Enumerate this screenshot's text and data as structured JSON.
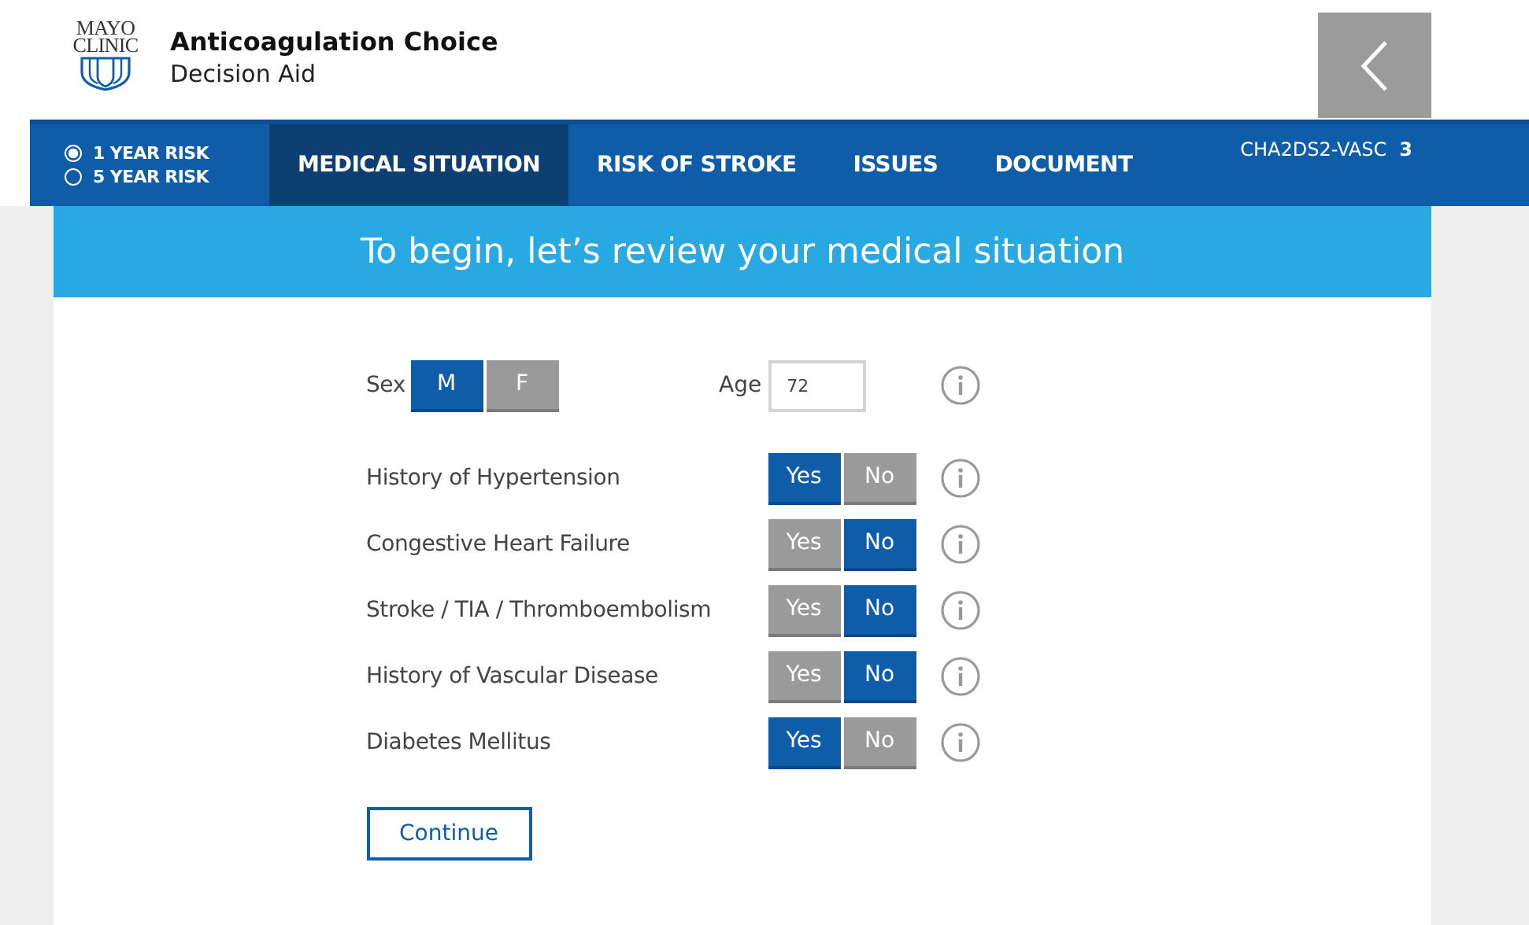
{
  "logo": {
    "line_1": "MAYO",
    "line_2": "CLINIC"
  },
  "app": {
    "title": "Anticoagulation Choice",
    "subtitle": "Decision Aid"
  },
  "risk_options": [
    {
      "label": "1 YEAR RISK",
      "selected": true
    },
    {
      "label": "5 YEAR RISK",
      "selected": false
    }
  ],
  "tabs": [
    {
      "label": "MEDICAL SITUATION",
      "selected": true
    },
    {
      "label": "RISK OF STROKE",
      "selected": false
    },
    {
      "label": "ISSUES",
      "selected": false
    },
    {
      "label": "DOCUMENT",
      "selected": false
    }
  ],
  "score": {
    "label": "CHA2DS2-VASC",
    "value": "3"
  },
  "banner": "To begin, let’s review your medical situation",
  "sex": {
    "label": "Sex",
    "options": [
      {
        "label": "M",
        "selected": true
      },
      {
        "label": "F",
        "selected": false
      }
    ]
  },
  "age": {
    "label": "Age",
    "value": "72"
  },
  "conditions": [
    {
      "label": "History of Hypertension",
      "options": [
        {
          "label": "Yes",
          "selected": true
        },
        {
          "label": "No",
          "selected": false
        }
      ]
    },
    {
      "label": "Congestive Heart Failure",
      "options": [
        {
          "label": "Yes",
          "selected": false
        },
        {
          "label": "No",
          "selected": true
        }
      ]
    },
    {
      "label": "Stroke / TIA / Thromboembolism",
      "options": [
        {
          "label": "Yes",
          "selected": false
        },
        {
          "label": "No",
          "selected": true
        }
      ]
    },
    {
      "label": "History of Vascular Disease",
      "options": [
        {
          "label": "Yes",
          "selected": false
        },
        {
          "label": "No",
          "selected": true
        }
      ]
    },
    {
      "label": "Diabetes Mellitus",
      "options": [
        {
          "label": "Yes",
          "selected": true
        },
        {
          "label": "No",
          "selected": false
        }
      ]
    }
  ],
  "continue_button": "Continue"
}
